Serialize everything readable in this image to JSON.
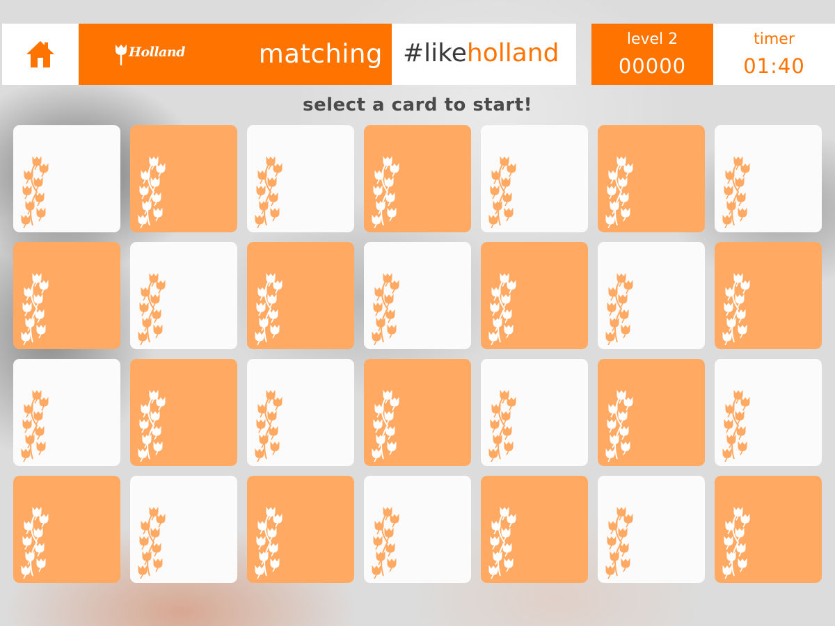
{
  "header": {
    "home_icon": "home-icon",
    "brand_logo_text": "Holland",
    "game_title": "matching",
    "hashtag_prefix": "#like",
    "hashtag_suffix": "holland",
    "level_label": "level 2",
    "score": "00000",
    "timer_label": "timer",
    "timer_value": "01:40"
  },
  "instruction": "select a card to start!",
  "colors": {
    "brand_orange": "#ff7300",
    "card_orange": "#ffa963",
    "card_white": "#fbfbfb",
    "text_dark": "#4a4a4a"
  },
  "board": {
    "rows": 4,
    "columns": 7,
    "card_back_icon": "tulip-pattern-icon",
    "cards": [
      "light",
      "dark",
      "light",
      "dark",
      "light",
      "dark",
      "light",
      "dark",
      "light",
      "dark",
      "light",
      "dark",
      "light",
      "dark",
      "light",
      "dark",
      "light",
      "dark",
      "light",
      "dark",
      "light",
      "dark",
      "light",
      "dark",
      "light",
      "dark",
      "light",
      "dark"
    ]
  }
}
